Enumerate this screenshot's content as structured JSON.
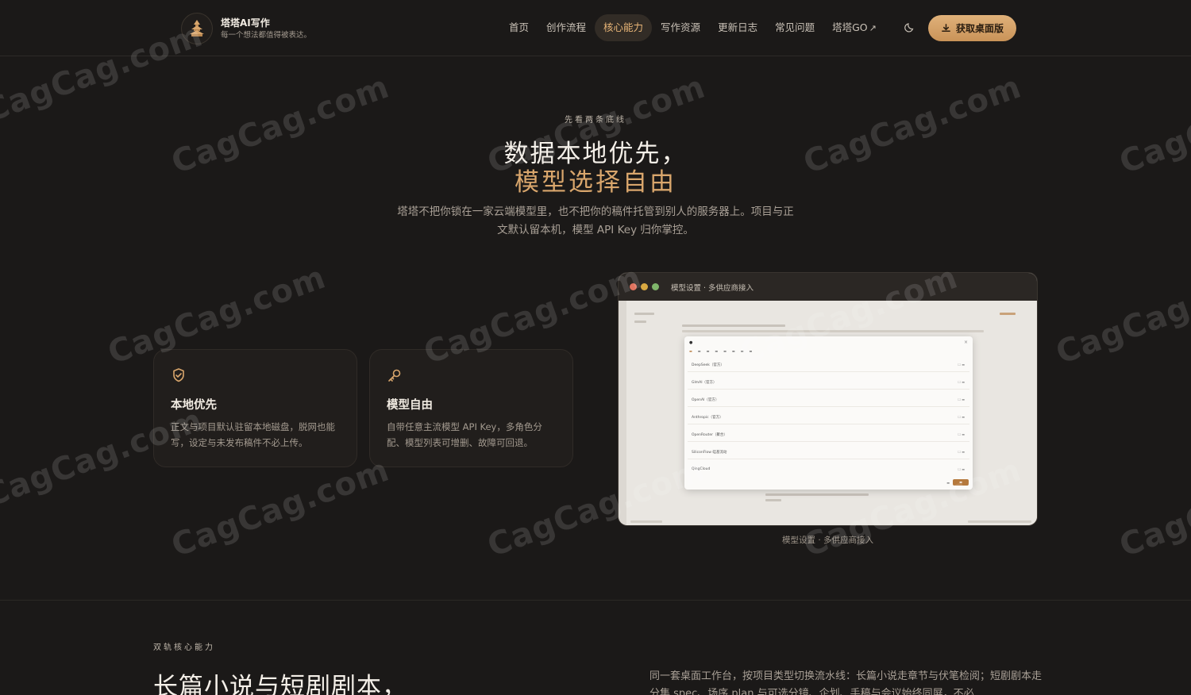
{
  "header": {
    "brand_name": "塔塔AI写作",
    "brand_slogan": "每一个想法都值得被表达。",
    "nav": [
      {
        "label": "首页"
      },
      {
        "label": "创作流程"
      },
      {
        "label": "核心能力",
        "active": true
      },
      {
        "label": "写作资源"
      },
      {
        "label": "更新日志"
      },
      {
        "label": "常见问题"
      },
      {
        "label": "塔塔GO",
        "external": true
      }
    ],
    "download_label": "获取桌面版"
  },
  "hero": {
    "eyebrow": "先看两条底线",
    "title_line1": "数据本地优先，",
    "title_line2": "模型选择自由",
    "description": "塔塔不把你锁在一家云端模型里，也不把你的稿件托管到别人的服务器上。项目与正文默认留本机，模型 API Key 归你掌控。"
  },
  "cards": [
    {
      "icon": "shield-check-icon",
      "title": "本地优先",
      "desc": "正文与项目默认驻留本地磁盘，脱网也能写，设定与未发布稿件不必上传。"
    },
    {
      "icon": "key-icon",
      "title": "模型自由",
      "desc": "自带任意主流模型 API Key，多角色分配、模型列表可增删、故障可回退。"
    }
  ],
  "screenshot": {
    "window_title": "模型设置 · 多供应商接入",
    "caption": "模型设置 · 多供应商接入",
    "providers": [
      "DeepSeek（官方）",
      "GlmAI（官方）",
      "OpenAI（官方）",
      "Anthropic（官方）",
      "OpenRouter（聚合）",
      "SiliconFlow 硅基流动",
      "QingCloud"
    ]
  },
  "section2": {
    "eyebrow": "双轨核心能力",
    "title": "长篇小说与短剧剧本，",
    "description": "同一套桌面工作台，按项目类型切换流水线：长篇小说走章节与伏笔检阅；短剧剧本走分集 spec、场序 plan 与可选分镜、企划、手稿与会议始终同屏，不必"
  },
  "watermark": "CagCag.com",
  "colors": {
    "accent": "#d9a66c",
    "background": "#1b1918",
    "button": "#d7a56a"
  }
}
